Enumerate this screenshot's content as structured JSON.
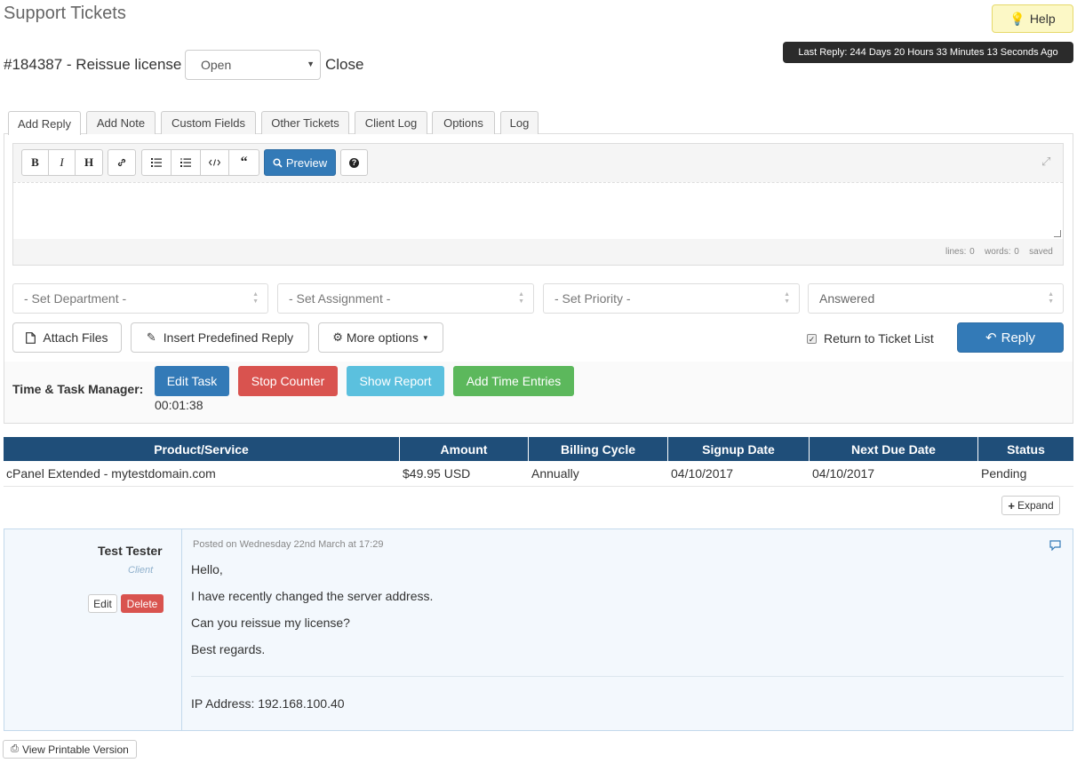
{
  "header": {
    "page_title": "Support Tickets",
    "help_label": "Help",
    "last_reply": "Last Reply: 244 Days 20 Hours 33 Minutes 13 Seconds Ago"
  },
  "ticket": {
    "title": "#184387 - Reissue license",
    "status_value": "Open",
    "close_label": "Close"
  },
  "tabs": [
    "Add Reply",
    "Add Note",
    "Custom Fields",
    "Other Tickets",
    "Client Log",
    "Options",
    "Log"
  ],
  "editor": {
    "bold": "B",
    "italic": "I",
    "heading": "H",
    "preview_label": "Preview",
    "help_label": "?",
    "status_lines": "lines: 0",
    "status_words": "words: 0",
    "status_saved": "saved"
  },
  "selects": {
    "department": "- Set Department -",
    "assignment": "- Set Assignment -",
    "priority": "- Set Priority -",
    "status": "Answered"
  },
  "actions": {
    "attach_files": "Attach Files",
    "insert_predefined": "Insert Predefined Reply",
    "more_options": "More options",
    "return_to_list": "Return to Ticket List",
    "reply": "Reply"
  },
  "time_manager": {
    "label": "Time & Task Manager:",
    "edit_task": "Edit Task",
    "stop_counter": "Stop Counter",
    "show_report": "Show Report",
    "add_time_entries": "Add Time Entries",
    "counter": "00:01:38"
  },
  "products_table": {
    "headers": [
      "Product/Service",
      "Amount",
      "Billing Cycle",
      "Signup Date",
      "Next Due Date",
      "Status"
    ],
    "rows": [
      [
        "cPanel Extended - mytestdomain.com",
        "$49.95 USD",
        "Annually",
        "04/10/2017",
        "04/10/2017",
        "Pending"
      ]
    ],
    "expand_label": "Expand"
  },
  "message": {
    "author": "Test Tester",
    "role": "Client",
    "edit_label": "Edit",
    "delete_label": "Delete",
    "posted": "Posted on Wednesday 22nd March at 17:29",
    "lines": [
      "Hello,",
      "I have recently changed the server address.",
      "Can you reissue my license?",
      "Best regards."
    ],
    "ip": "IP Address: 192.168.100.40"
  },
  "footer": {
    "print_label": "View Printable Version"
  },
  "colors": {
    "primary": "#337ab7",
    "danger": "#d9534f",
    "info": "#5bc0de",
    "success": "#5cb85c",
    "table_header": "#1f4e79"
  }
}
